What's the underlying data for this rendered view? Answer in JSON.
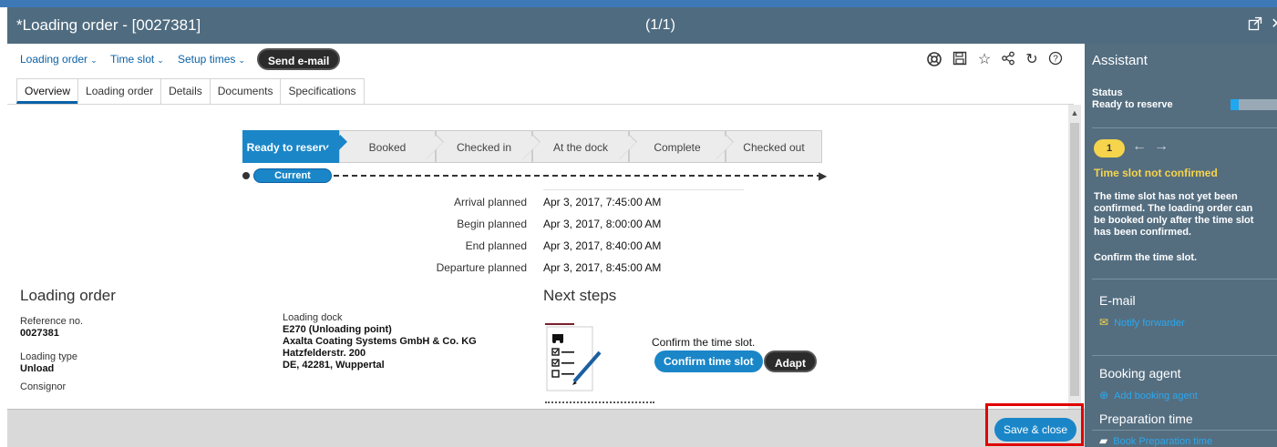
{
  "window": {
    "title": "*Loading order - [0027381]",
    "record_counter": "(1/1)",
    "popout_icon": "popout-icon",
    "close_icon": "close-icon"
  },
  "toolbar": {
    "menus": [
      {
        "label": "Loading order",
        "icon": "chevron-down-icon"
      },
      {
        "label": "Time slot",
        "icon": "chevron-down-icon"
      },
      {
        "label": "Setup times",
        "icon": "chevron-down-icon"
      }
    ],
    "send_email_label": "Send e-mail",
    "icons": [
      "support-icon",
      "save-icon",
      "star-icon",
      "share-icon",
      "refresh-icon",
      "help-icon"
    ]
  },
  "tabs": [
    "Overview",
    "Loading order",
    "Details",
    "Documents",
    "Specifications"
  ],
  "active_tab": "Overview",
  "progress_steps": {
    "steps": [
      "Ready to reserve",
      "Booked",
      "Checked in",
      "At the dock",
      "Complete",
      "Checked out"
    ],
    "active": "Ready to reserve",
    "current_label": "Current"
  },
  "schedule": [
    {
      "label": "Arrival planned",
      "value": "Apr 3, 2017, 7:45:00 AM"
    },
    {
      "label": "Begin planned",
      "value": "Apr 3, 2017, 8:00:00 AM"
    },
    {
      "label": "End planned",
      "value": "Apr 3, 2017, 8:40:00 AM"
    },
    {
      "label": "Departure planned",
      "value": "Apr 3, 2017, 8:45:00 AM"
    }
  ],
  "loading_order": {
    "title": "Loading order",
    "reference_label": "Reference no.",
    "reference_value": "0027381",
    "type_label": "Loading type",
    "type_value": "Unload",
    "consignor_label": "Consignor",
    "dock_label": "Loading dock",
    "dock_lines": [
      "E270 (Unloading point)",
      "Axalta Coating Systems GmbH & Co. KG",
      "Hatzfelderstr. 200",
      "DE, 42281, Wuppertal"
    ]
  },
  "next_steps": {
    "title": "Next steps",
    "text": "Confirm the time slot.",
    "confirm_label": "Confirm time slot",
    "adapt_label": "Adapt",
    "illustration_icon": "checklist-icon"
  },
  "footer": {
    "save_close_label": "Save & close"
  },
  "assistant": {
    "title": "Assistant",
    "status_label": "Status",
    "status_value": "Ready to reserve",
    "status_progress": 0.17,
    "step_badge": "1",
    "warning_title": "Time slot not confirmed",
    "warning_body": "The time slot has not yet been confirmed. The loading order can be booked only after the time slot has been confirmed.",
    "action_text": "Confirm the time slot.",
    "email_title": "E-mail",
    "notify_link": "Notify forwarder",
    "booking_title": "Booking agent",
    "add_agent_link": "Add booking agent",
    "prep_title": "Preparation time",
    "prep_link": "Book Preparation time",
    "accent_color": "#2aa8ef",
    "warning_color": "#f6d44c"
  }
}
